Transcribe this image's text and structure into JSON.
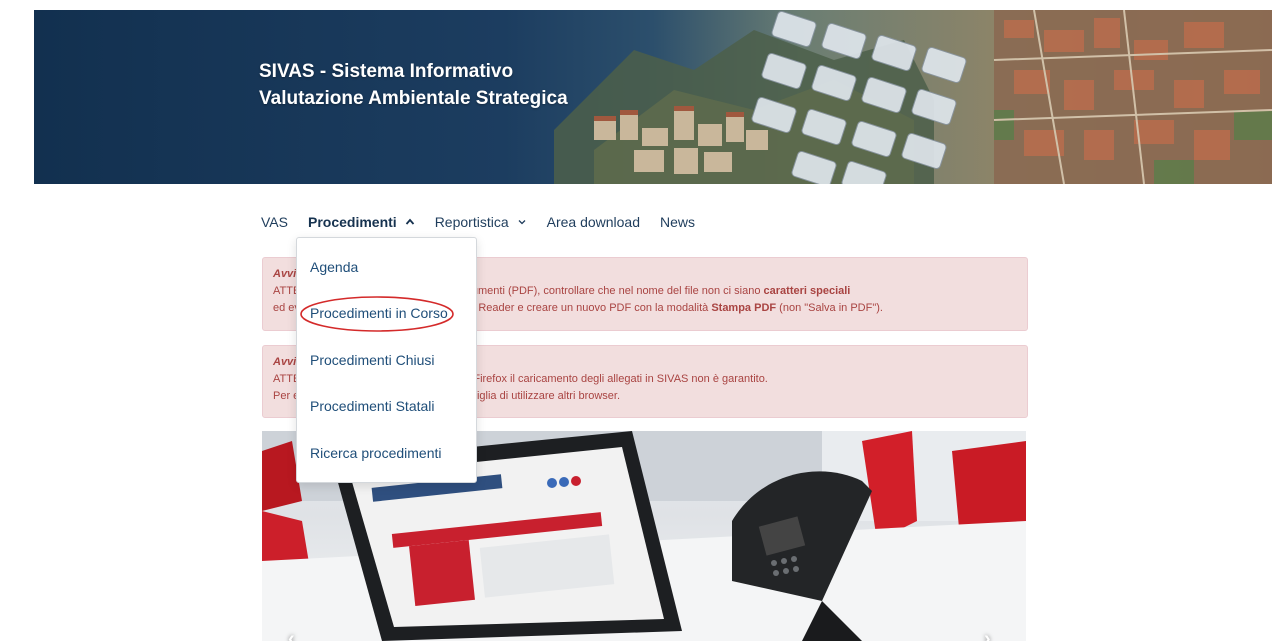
{
  "header": {
    "title_line1": "SIVAS - Sistema Informativo",
    "title_line2": "Valutazione Ambientale Strategica"
  },
  "nav": {
    "items": [
      {
        "label": "VAS"
      },
      {
        "label": "Procedimenti",
        "active": true,
        "caret": "chevron-up-icon"
      },
      {
        "label": "Reportistica",
        "caret": "chevron-down-icon"
      },
      {
        "label": "Area download"
      },
      {
        "label": "News"
      }
    ]
  },
  "dropdown": {
    "items": [
      {
        "label": "Agenda"
      },
      {
        "label": "Procedimenti in Corso",
        "highlighted": true
      },
      {
        "label": "Procedimenti Chiusi"
      },
      {
        "label": "Procedimenti Statali"
      },
      {
        "label": "Ricerca procedimenti"
      }
    ],
    "highlight_color": "#d42a2a"
  },
  "alerts": [
    {
      "heading": "Avvi",
      "line1_prefix": "ATTE",
      "line1_visible": "urante il caricamento di documenti (PDF), controllare che nel nome del file non ci siano",
      "line1_bold": "caratteri speciali",
      "line2_prefix": "ed ev",
      "line2_visible": "bat Reader e creare un nuovo PDF con la modalità",
      "line2_bold": "Stampa PDF",
      "line2_suffix": "(non \"Salva in PDF\")."
    },
    {
      "heading": "Avvi",
      "line1_prefix": "ATTE",
      "line1_visible": "Firefox il caricamento degli allegati in SIVAS non è garantito.",
      "line2_prefix": "Per e",
      "line2_visible": "nsiglia di utilizzare altri browser."
    }
  ],
  "carousel": {
    "prev": "‹",
    "next": "›"
  },
  "colors": {
    "banner_bg": "#12304f",
    "nav_text": "#1f3d5c",
    "alert_bg": "#f2dede",
    "alert_text": "#a94442",
    "link": "#1f4e79"
  }
}
